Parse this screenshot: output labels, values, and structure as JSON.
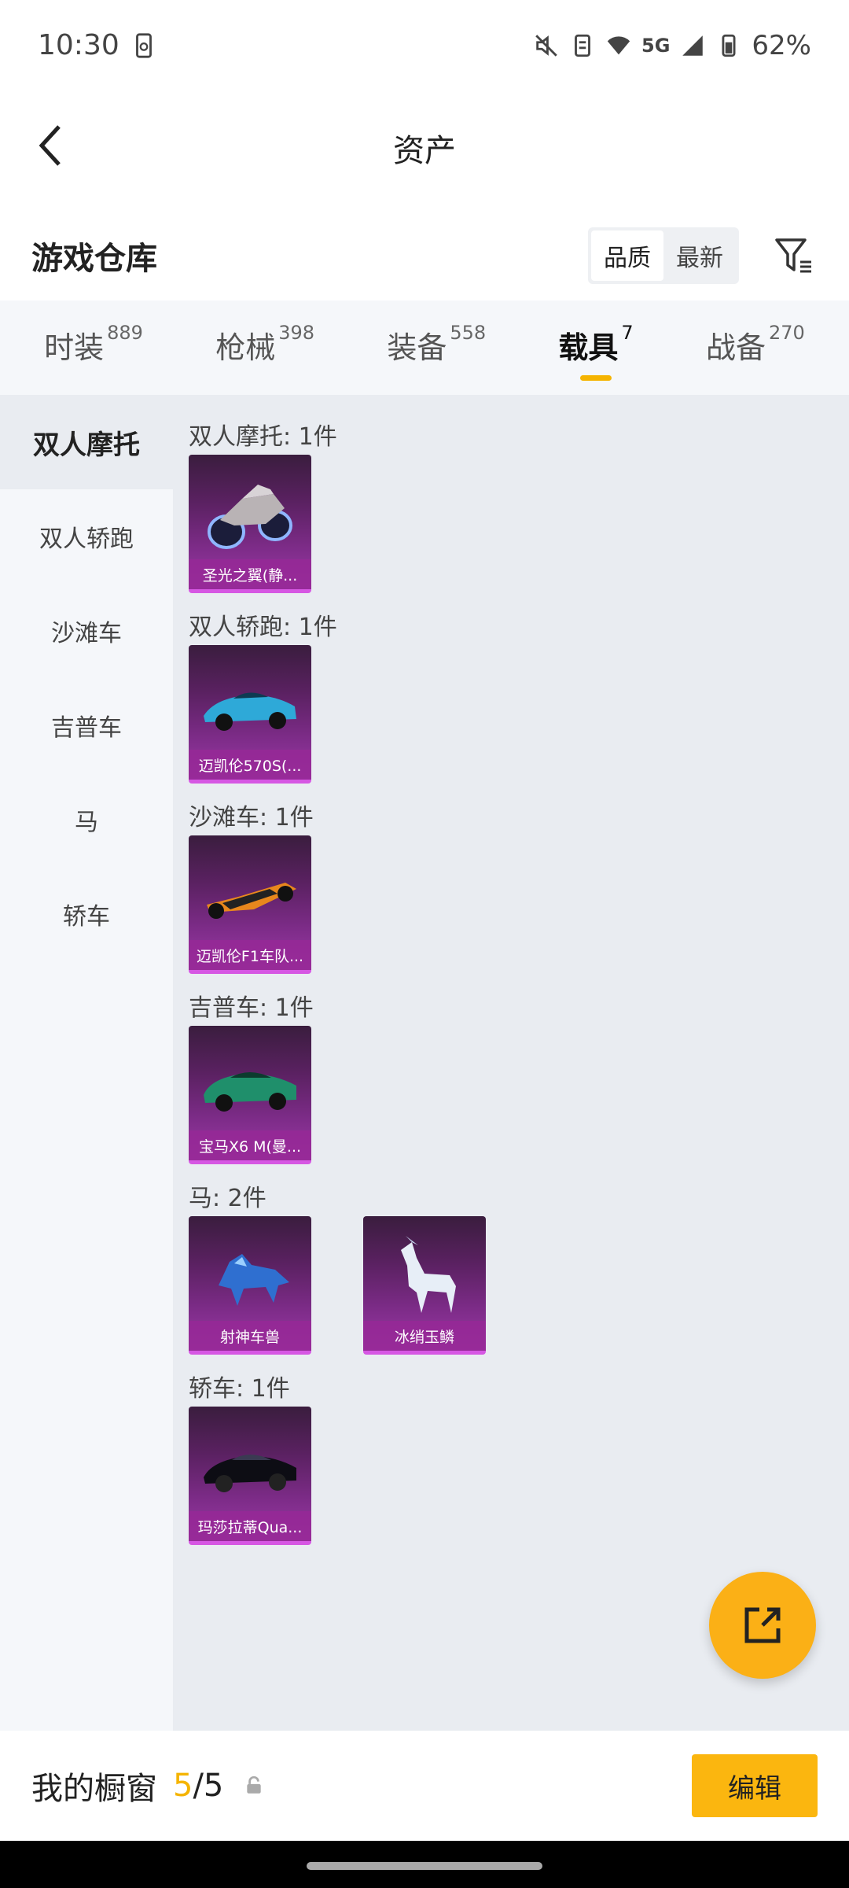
{
  "status": {
    "time": "10:30",
    "battery": "62%",
    "network": "5G"
  },
  "header": {
    "title": "资产"
  },
  "section": {
    "title": "游戏仓库",
    "sort_options": [
      "品质",
      "最新"
    ]
  },
  "tabs": [
    {
      "label": "时装",
      "count": "889"
    },
    {
      "label": "枪械",
      "count": "398"
    },
    {
      "label": "装备",
      "count": "558"
    },
    {
      "label": "载具",
      "count": "7"
    },
    {
      "label": "战备",
      "count": "270"
    }
  ],
  "sidebar": {
    "items": [
      "双人摩托",
      "双人轿跑",
      "沙滩车",
      "吉普车",
      "马",
      "轿车"
    ]
  },
  "groups": [
    {
      "title": "双人摩托: 1件",
      "items": [
        {
          "name": "圣光之翼(静...",
          "art": "motorcycle"
        }
      ]
    },
    {
      "title": "双人轿跑: 1件",
      "items": [
        {
          "name": "迈凯伦570S(...",
          "art": "sports-car"
        }
      ]
    },
    {
      "title": "沙滩车: 1件",
      "items": [
        {
          "name": "迈凯伦F1车队...",
          "art": "f1-car"
        }
      ]
    },
    {
      "title": "吉普车: 1件",
      "items": [
        {
          "name": "宝马X6 M(曼...",
          "art": "suv"
        }
      ]
    },
    {
      "title": "马: 2件",
      "items": [
        {
          "name": "射神车兽",
          "art": "beast"
        },
        {
          "name": "冰绡玉鳞",
          "art": "ice-horse"
        }
      ]
    },
    {
      "title": "轿车: 1件",
      "items": [
        {
          "name": "玛莎拉蒂Qua...",
          "art": "sedan"
        }
      ]
    }
  ],
  "bottom": {
    "label": "我的橱窗",
    "current": "5",
    "total": "/5",
    "edit": "编辑"
  },
  "colors": {
    "accent": "#fbb60f",
    "card_bg": "#7e2c89",
    "card_border": "#d657e3"
  }
}
